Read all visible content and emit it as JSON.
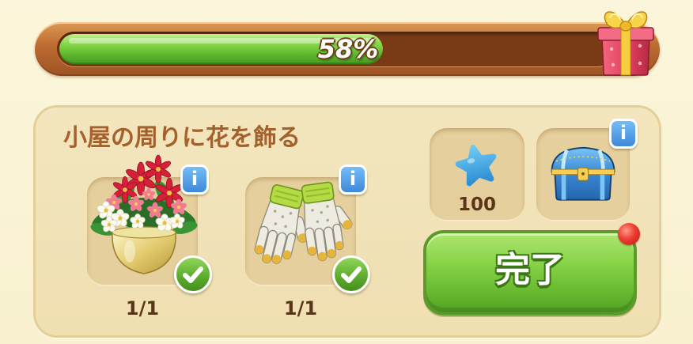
{
  "progress": {
    "value": 0.58,
    "percent_label": "58%",
    "reward_icon": "gift-box-icon"
  },
  "task": {
    "title": "小屋の周りに花を飾る",
    "items": [
      {
        "icon": "flower-vase-icon",
        "count": "1/1",
        "completed": true,
        "completed_icon": "checkmark-icon"
      },
      {
        "icon": "garden-gloves-icon",
        "count": "1/1",
        "completed": true,
        "completed_icon": "checkmark-icon"
      }
    ],
    "rewards": [
      {
        "icon": "blue-star-icon",
        "amount": "100"
      },
      {
        "icon": "treasure-chest-icon",
        "has_info": true
      }
    ],
    "complete_button": {
      "label": "完了",
      "notification_dot": true
    }
  },
  "ui": {
    "info_label": "i",
    "info_icon": "info-icon"
  },
  "colors": {
    "background": "#faf4d6",
    "progress_fill": "#6cc63c",
    "progress_track": "#7b3a16",
    "panel": "#f1e2b7",
    "title_text": "#a5612b",
    "count_text": "#5b3519",
    "info_badge": "#4a90dc",
    "complete_button": "#7ccb3e",
    "notification": "#e5312a"
  }
}
